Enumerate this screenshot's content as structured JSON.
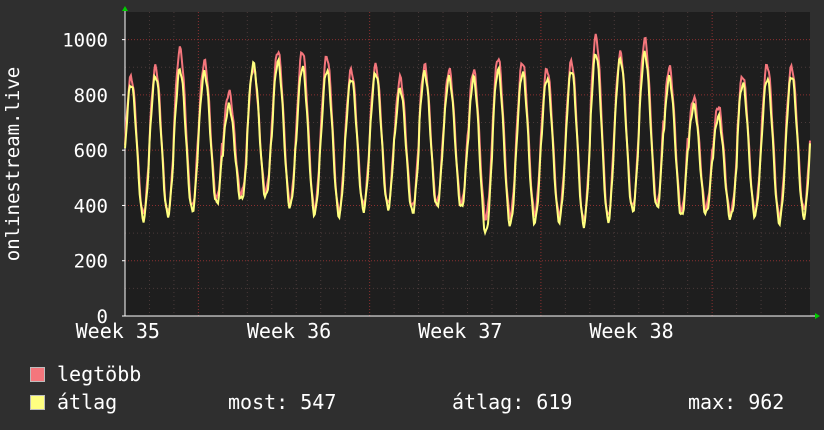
{
  "chart_data": {
    "type": "line",
    "ylabel": "onlinestream.live",
    "ylim": [
      0,
      1100
    ],
    "yticks": [
      0,
      200,
      400,
      600,
      800,
      1000
    ],
    "grid": true,
    "x_categories": [
      "Week 35",
      "Week 36",
      "Week 37",
      "Week 38"
    ],
    "days": 28,
    "series": [
      {
        "name": "legtöbb",
        "color": "#f4767c",
        "daily_min": [
          370,
          375,
          395,
          425,
          440,
          450,
          410,
          385,
          380,
          400,
          405,
          395,
          410,
          405,
          355,
          360,
          370,
          365,
          345,
          360,
          395,
          405,
          380,
          390,
          370,
          380,
          360,
          385
        ],
        "daily_max": [
          865,
          900,
          965,
          920,
          810,
          895,
          960,
          960,
          940,
          890,
          905,
          860,
          905,
          890,
          890,
          935,
          920,
          895,
          920,
          1010,
          950,
          1000,
          900,
          790,
          760,
          870,
          910,
          900
        ]
      },
      {
        "name": "átlag",
        "color": "#ffff80",
        "daily_min": [
          350,
          365,
          380,
          405,
          420,
          430,
          395,
          370,
          365,
          385,
          390,
          375,
          395,
          390,
          300,
          330,
          340,
          345,
          330,
          345,
          380,
          390,
          360,
          370,
          355,
          365,
          340,
          360
        ],
        "daily_max": [
          840,
          870,
          890,
          880,
          760,
          910,
          920,
          900,
          890,
          860,
          880,
          820,
          880,
          860,
          860,
          890,
          880,
          860,
          890,
          950,
          930,
          950,
          860,
          760,
          720,
          840,
          860,
          870
        ]
      }
    ]
  },
  "legend": {
    "max_label": "legtöbb",
    "avg_label": "átlag"
  },
  "stats": {
    "most": "most: 547",
    "atlag": "átlag: 619",
    "max": "max: 962"
  }
}
